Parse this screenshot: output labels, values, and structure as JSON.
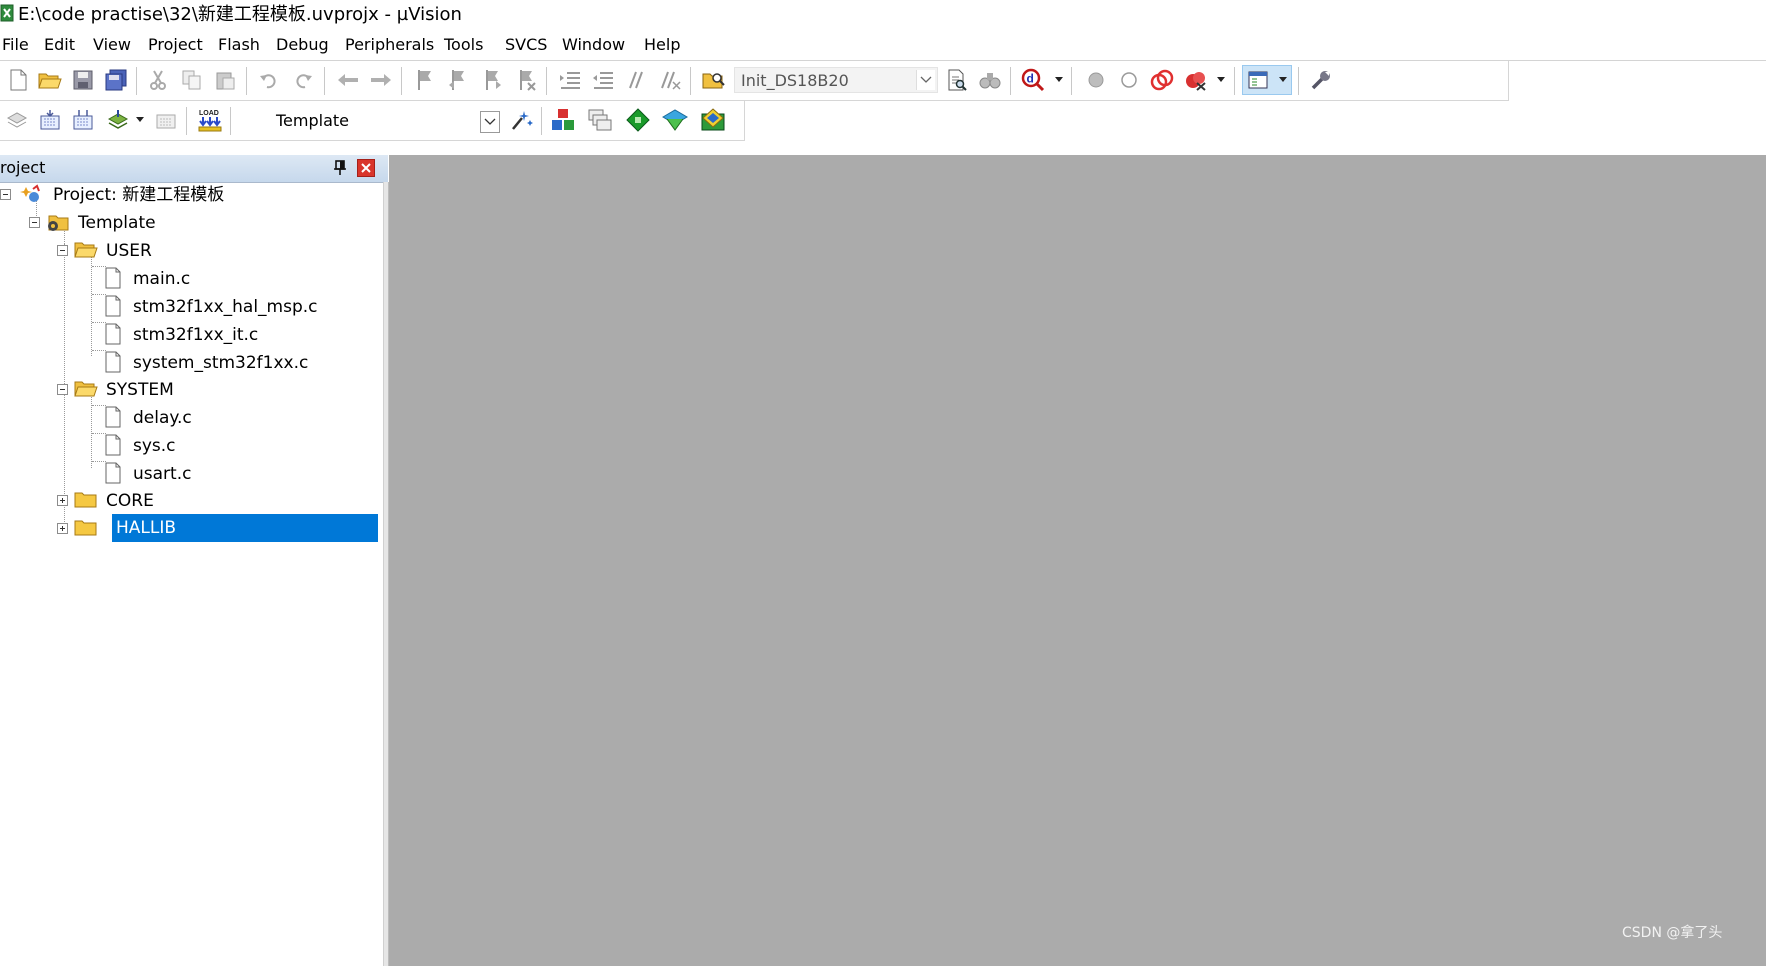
{
  "window": {
    "title": "E:\\code practise\\32\\新建工程模板.uvprojx - µVision"
  },
  "menu": {
    "file": "File",
    "edit": "Edit",
    "view": "View",
    "project": "Project",
    "flash": "Flash",
    "debug": "Debug",
    "peripherals": "Peripherals",
    "tools": "Tools",
    "svcs": "SVCS",
    "window": "Window",
    "help": "Help"
  },
  "toolbar": {
    "find_combo_value": "Init_DS18B20",
    "target_combo_value": "Template",
    "load_label": "LOAD"
  },
  "project_panel": {
    "title": "roject",
    "tree": {
      "root": "Project: 新建工程模板",
      "target": "Template",
      "user_group": "USER",
      "user_files": [
        "main.c",
        "stm32f1xx_hal_msp.c",
        "stm32f1xx_it.c",
        "system_stm32f1xx.c"
      ],
      "system_group": "SYSTEM",
      "system_files": [
        "delay.c",
        "sys.c",
        "usart.c"
      ],
      "core_group": "CORE",
      "hallib_group": "HALLIB"
    }
  },
  "watermark": "CSDN @拿了头",
  "colors": {
    "selection": "#0078d7",
    "editor_background": "#ababab",
    "panel_header": "#c6d8ec",
    "close_button": "#d9352b"
  }
}
